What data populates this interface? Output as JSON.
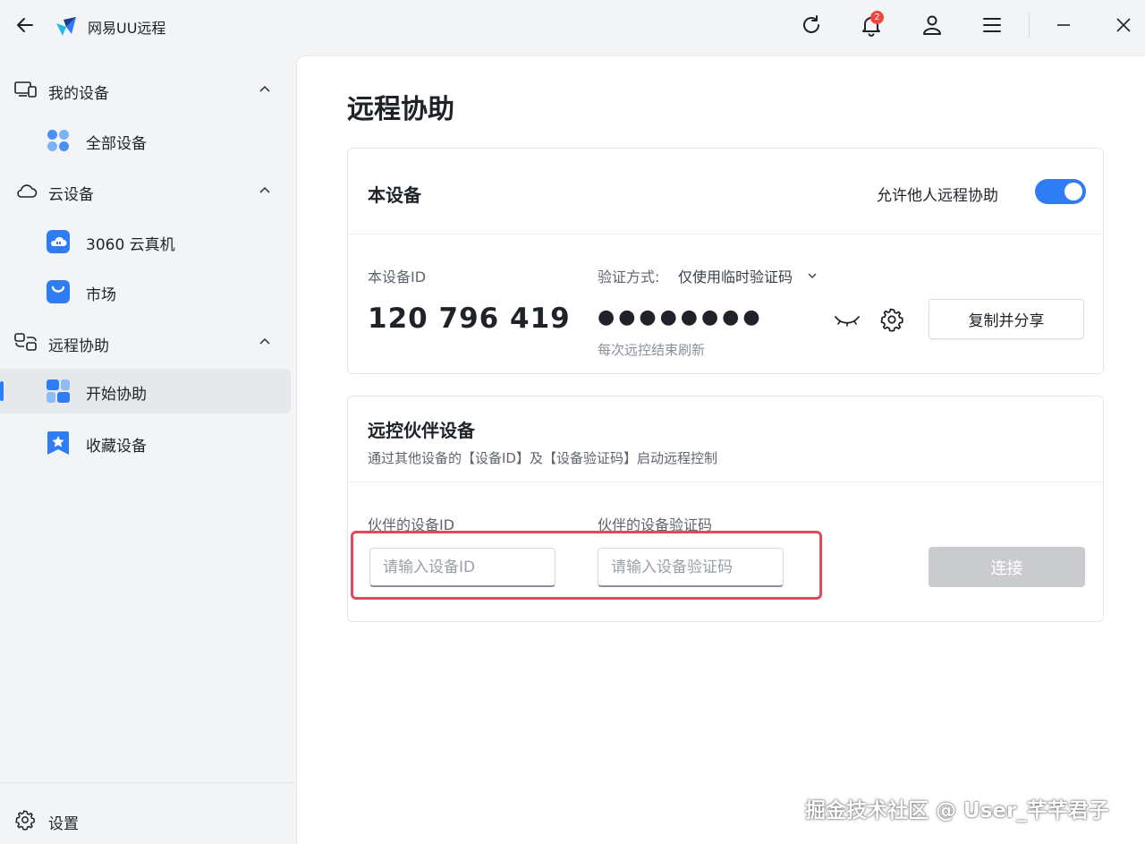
{
  "app": {
    "title": "网易UU远程",
    "notification_count": "2"
  },
  "sidebar": {
    "groups": [
      {
        "label": "我的设备",
        "items": [
          {
            "label": "全部设备"
          }
        ]
      },
      {
        "label": "云设备",
        "items": [
          {
            "label": "3060 云真机"
          },
          {
            "label": "市场"
          }
        ]
      },
      {
        "label": "远程协助",
        "items": [
          {
            "label": "开始协助"
          },
          {
            "label": "收藏设备"
          }
        ]
      }
    ],
    "active_item": "开始协助",
    "settings_label": "设置"
  },
  "main": {
    "page_title": "远程协助",
    "this_device": {
      "title": "本设备",
      "allow_label": "允许他人远程协助",
      "allow_enabled": true,
      "id_label": "本设备ID",
      "device_id": "120 796 419",
      "verify_label": "验证方式:",
      "verify_value": "仅使用临时验证码",
      "password_masked": "●●●●●●●●",
      "refresh_hint": "每次远控结束刷新",
      "copy_share_label": "复制并分享"
    },
    "partner": {
      "title": "远控伙伴设备",
      "description": "通过其他设备的【设备ID】及【设备验证码】启动远程控制",
      "id_label": "伙伴的设备ID",
      "id_placeholder": "请输入设备ID",
      "code_label": "伙伴的设备验证码",
      "code_placeholder": "请输入设备验证码",
      "connect_label": "连接"
    }
  },
  "watermark": "掘金技术社区 @ User_芊芊君子",
  "colors": {
    "accent": "#2f7df6",
    "highlight": "#e5475d",
    "disabled": "#c9cbce"
  }
}
